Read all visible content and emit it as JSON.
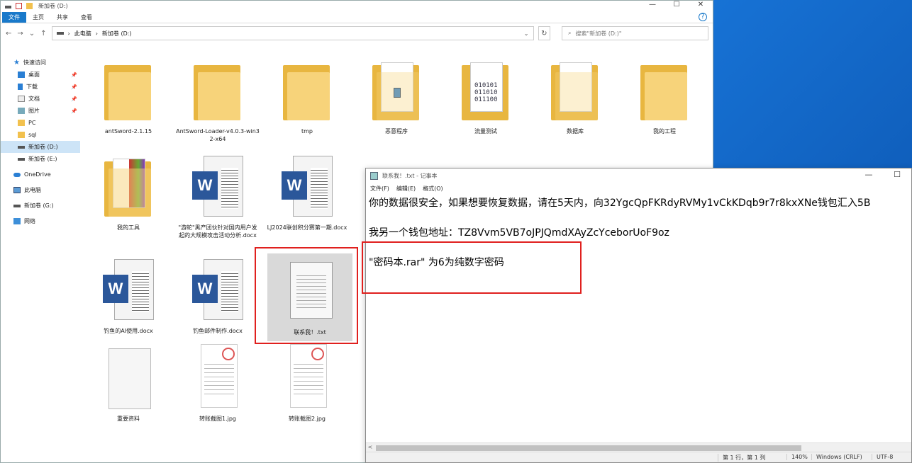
{
  "explorer": {
    "title": "新加卷 (D:)",
    "controls": {
      "minimize": "—",
      "maximize": "☐",
      "close": "✕"
    },
    "ribbon_tabs": [
      "文件",
      "主页",
      "共享",
      "查看"
    ],
    "help": "?",
    "nav": {
      "back": "←",
      "forward": "→",
      "recent": "⌄",
      "up": "↑"
    },
    "address": {
      "sep1": "›",
      "crumb1": "此电脑",
      "sep2": "›",
      "crumb2": "新加卷 (D:)",
      "chevron": "⌄"
    },
    "refresh": "↻",
    "search_placeholder": "搜索\"新加卷 (D:)\"",
    "search_icon": "⌕"
  },
  "sidebar": {
    "quick_access": "快速访问",
    "items": [
      {
        "label": "桌面",
        "pin": "📌"
      },
      {
        "label": "下载",
        "pin": "📌"
      },
      {
        "label": "文档",
        "pin": "📌"
      },
      {
        "label": "图片",
        "pin": "📌"
      },
      {
        "label": "PC"
      },
      {
        "label": "sql"
      },
      {
        "label": "新加卷 (D:)"
      },
      {
        "label": "新加卷 (E:)"
      }
    ],
    "onedrive": "OneDrive",
    "this_pc": "此电脑",
    "drive_g": "新加卷 (G:)",
    "network": "网络"
  },
  "files": [
    {
      "label": "antSword-2.1.15"
    },
    {
      "label": "AntSword-Loader-v4.0.3-win32-x64"
    },
    {
      "label": "tmp"
    },
    {
      "label": "恶意程序"
    },
    {
      "label": "流量测试",
      "badge": "010101\n011010\n011100"
    },
    {
      "label": "数据库"
    },
    {
      "label": "我的工程"
    },
    {
      "label": "我的工具"
    },
    {
      "label": "\"游蛇\"黑产团伙针对国内用户发起的大规模攻击活动分析.docx"
    },
    {
      "label": "LJ2024联创积分赛第一期.docx"
    },
    {
      "label": "钓鱼的AI使用.docx"
    },
    {
      "label": "钓鱼邮件制作.docx"
    },
    {
      "label": "联系我！.txt"
    },
    {
      "label": "重要资料"
    },
    {
      "label": "转账截图1.jpg"
    },
    {
      "label": "转账截图2.jpg"
    }
  ],
  "word_letter": "W",
  "notepad": {
    "title": "联系我！.txt - 记事本",
    "controls": {
      "minimize": "—",
      "maximize": "☐"
    },
    "menu": [
      "文件(F)",
      "编辑(E)",
      "格式(O)"
    ],
    "lines": [
      "你的数据很安全，如果想要恢复数据，请在5天内，向32YgcQpFKRdyRVMy1vCkKDqb9r7r8kxXNe钱包汇入5B",
      "我另一个钱包地址：TZ8Vvm5VB7oJPJQmdXAyZcYceborUoF9oz",
      "\"密码本.rar\" 为6为纯数字密码"
    ],
    "scroll_left": "<",
    "status": {
      "position": "第 1 行，第 1 列",
      "zoom": "140%",
      "eol": "Windows (CRLF)",
      "encoding": "UTF-8"
    }
  },
  "colors": {
    "highlight": "#e0201e",
    "accent": "#1979ca",
    "word": "#2b579a"
  }
}
